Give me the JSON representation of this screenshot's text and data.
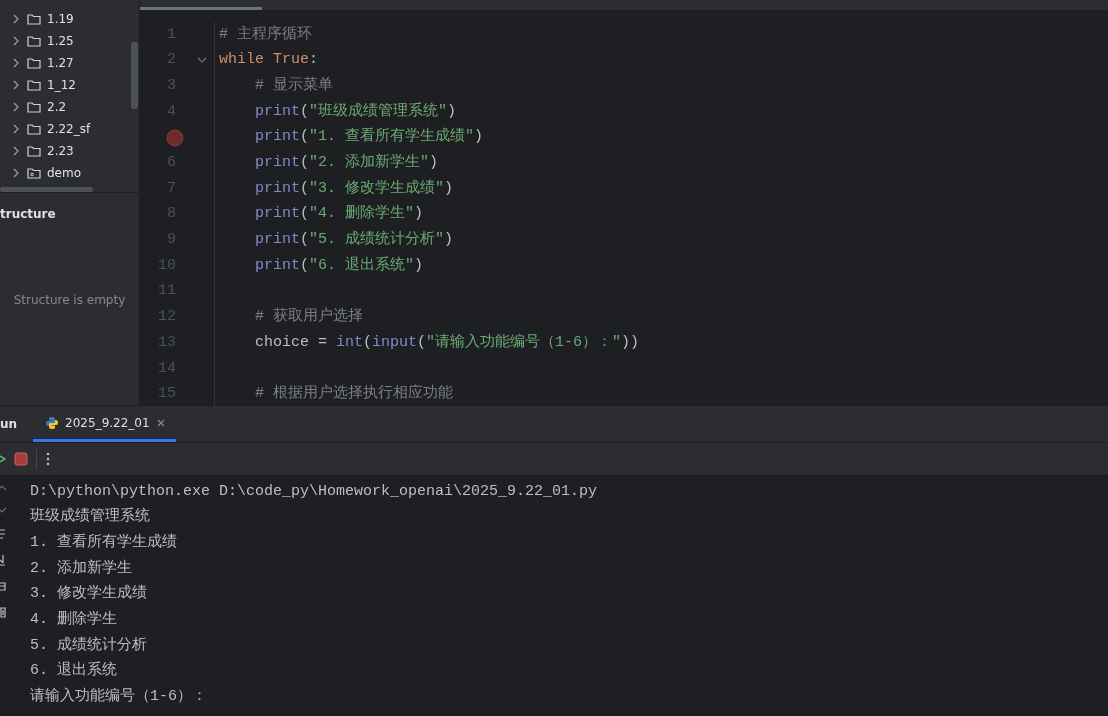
{
  "project_tree": {
    "items": [
      {
        "label": "1.19",
        "kind": "folder",
        "expanded": false
      },
      {
        "label": "1.25",
        "kind": "folder",
        "expanded": false
      },
      {
        "label": "1.27",
        "kind": "folder",
        "expanded": false
      },
      {
        "label": "1_12",
        "kind": "folder",
        "expanded": false
      },
      {
        "label": "2.2",
        "kind": "folder",
        "expanded": false
      },
      {
        "label": "2.22_sf",
        "kind": "folder",
        "expanded": false
      },
      {
        "label": "2.23",
        "kind": "folder",
        "expanded": false
      },
      {
        "label": "demo",
        "kind": "package",
        "expanded": false
      }
    ]
  },
  "structure": {
    "title": "tructure",
    "empty_text": "Structure is empty"
  },
  "editor": {
    "lines": [
      {
        "number": "1",
        "tokens": [
          {
            "kind": "comment",
            "text": "# 主程序循环"
          }
        ]
      },
      {
        "number": "2",
        "foldable": true,
        "tokens": [
          {
            "kind": "keyword",
            "text": "while"
          },
          {
            "kind": "keyword",
            "text": "True"
          },
          {
            "kind": "plain",
            "text": ":"
          }
        ]
      },
      {
        "number": "3",
        "indented": true,
        "tokens": [
          {
            "kind": "comment",
            "text": "# 显示菜单"
          }
        ]
      },
      {
        "number": "4",
        "indented": true,
        "tokens": [
          {
            "kind": "builtin",
            "text": "print"
          },
          {
            "kind": "plain",
            "text": "("
          },
          {
            "kind": "string",
            "text": "\"班级成绩管理系统\""
          },
          {
            "kind": "plain",
            "text": ")"
          }
        ]
      },
      {
        "breakpoint": true,
        "indented": true,
        "tokens": [
          {
            "kind": "builtin",
            "text": "print"
          },
          {
            "kind": "plain",
            "text": "("
          },
          {
            "kind": "string",
            "text": "\"1. 查看所有学生成绩\""
          },
          {
            "kind": "plain",
            "text": ")"
          }
        ]
      },
      {
        "number": "6",
        "indented": true,
        "tokens": [
          {
            "kind": "builtin",
            "text": "print"
          },
          {
            "kind": "plain",
            "text": "("
          },
          {
            "kind": "string",
            "text": "\"2. 添加新学生\""
          },
          {
            "kind": "plain",
            "text": ")"
          }
        ]
      },
      {
        "number": "7",
        "indented": true,
        "tokens": [
          {
            "kind": "builtin",
            "text": "print"
          },
          {
            "kind": "plain",
            "text": "("
          },
          {
            "kind": "string",
            "text": "\"3. 修改学生成绩\""
          },
          {
            "kind": "plain",
            "text": ")"
          }
        ]
      },
      {
        "number": "8",
        "indented": true,
        "tokens": [
          {
            "kind": "builtin",
            "text": "print"
          },
          {
            "kind": "plain",
            "text": "("
          },
          {
            "kind": "string",
            "text": "\"4. 删除学生\""
          },
          {
            "kind": "plain",
            "text": ")"
          }
        ]
      },
      {
        "number": "9",
        "indented": true,
        "tokens": [
          {
            "kind": "builtin",
            "text": "print"
          },
          {
            "kind": "plain",
            "text": "("
          },
          {
            "kind": "string",
            "text": "\"5. 成绩统计分析\""
          },
          {
            "kind": "plain",
            "text": ")"
          }
        ]
      },
      {
        "number": "10",
        "indented": true,
        "tokens": [
          {
            "kind": "builtin",
            "text": "print"
          },
          {
            "kind": "plain",
            "text": "("
          },
          {
            "kind": "string",
            "text": "\"6. 退出系统\""
          },
          {
            "kind": "plain",
            "text": ")"
          }
        ]
      },
      {
        "number": "11"
      },
      {
        "number": "12",
        "indented": true,
        "tokens": [
          {
            "kind": "comment",
            "text": "# 获取用户选择"
          }
        ]
      },
      {
        "number": "13",
        "indented": true,
        "tokens": [
          {
            "kind": "plain",
            "text": "choice = "
          },
          {
            "kind": "builtin",
            "text": "int"
          },
          {
            "kind": "plain",
            "text": "("
          },
          {
            "kind": "builtin",
            "text": "input"
          },
          {
            "kind": "plain",
            "text": "("
          },
          {
            "kind": "string",
            "text": "\"请输入功能编号（1-6）：\""
          },
          {
            "kind": "plain",
            "text": "))"
          }
        ]
      },
      {
        "number": "14"
      },
      {
        "number": "15",
        "indented": true,
        "tokens": [
          {
            "kind": "comment",
            "text": "# 根据用户选择执行相应功能"
          }
        ]
      }
    ]
  },
  "run_panel": {
    "title": "un",
    "tabs": [
      {
        "label": "2025_9.22_01",
        "selected": true
      }
    ],
    "console": [
      "D:\\python\\python.exe D:\\code_py\\Homework_openai\\2025_9.22_01.py",
      "班级成绩管理系统",
      "1. 查看所有学生成绩",
      "2. 添加新学生",
      "3. 修改学生成绩",
      "4. 删除学生",
      "5. 成绩统计分析",
      "6. 退出系统",
      "请输入功能编号（1-6）："
    ]
  }
}
